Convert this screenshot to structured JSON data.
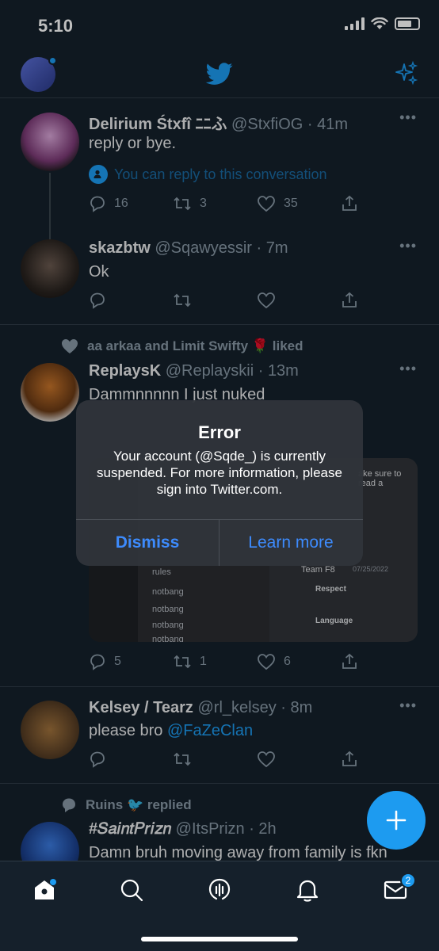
{
  "status": {
    "time": "5:10"
  },
  "tweets": [
    {
      "name": "Delirium Śtxfî ﾆﾆふ",
      "handle": "@StxfiOG · 41m",
      "text": "reply or bye.",
      "reply_notice": "You can reply to this conversation",
      "replies": "16",
      "retweets": "3",
      "likes": "35"
    },
    {
      "name": "skazbtw",
      "handle": "@Sqawyessir · 7m",
      "text": "Ok"
    },
    {
      "context": "aa arkaa and Limit Swifty 🌹 liked",
      "name": "ReplaysK",
      "handle": "@Replayskii · 13m",
      "text": "Dammnnnnn I just nuked",
      "replies": "5",
      "retweets": "1",
      "likes": "6",
      "media_texts": {
        "channel": "rules",
        "chan1": "notbang",
        "chan2": "notbang",
        "chan3": "notbang",
        "chan4": "notbang",
        "team": "Team F8",
        "date": "07/25/2022",
        "respect": "Respect",
        "language": "Language",
        "note": "ake sure to read a"
      }
    },
    {
      "name": "Kelsey / Tearz",
      "handle": "@rl_kelsey · 8m",
      "text_prefix": "please bro ",
      "mention": "@FaZeClan"
    },
    {
      "context": "Ruins 🐦 replied",
      "name": "#𝑆𝑎𝑖𝑛𝑡𝑃𝑟𝑖𝑧𝑛",
      "handle": "@ItsPrizn · 2h",
      "text": "Damn bruh moving away from family is fkn"
    }
  ],
  "alert": {
    "title": "Error",
    "message": "Your account (@Sqde_) is currently suspended. For more information, please sign into Twitter.com.",
    "dismiss": "Dismiss",
    "learn_more": "Learn more"
  },
  "tabbar": {
    "messages_badge": "2"
  },
  "colors": {
    "background": "#15202b",
    "accent": "#1d9bf0",
    "alert_button": "#3d8bfd"
  }
}
